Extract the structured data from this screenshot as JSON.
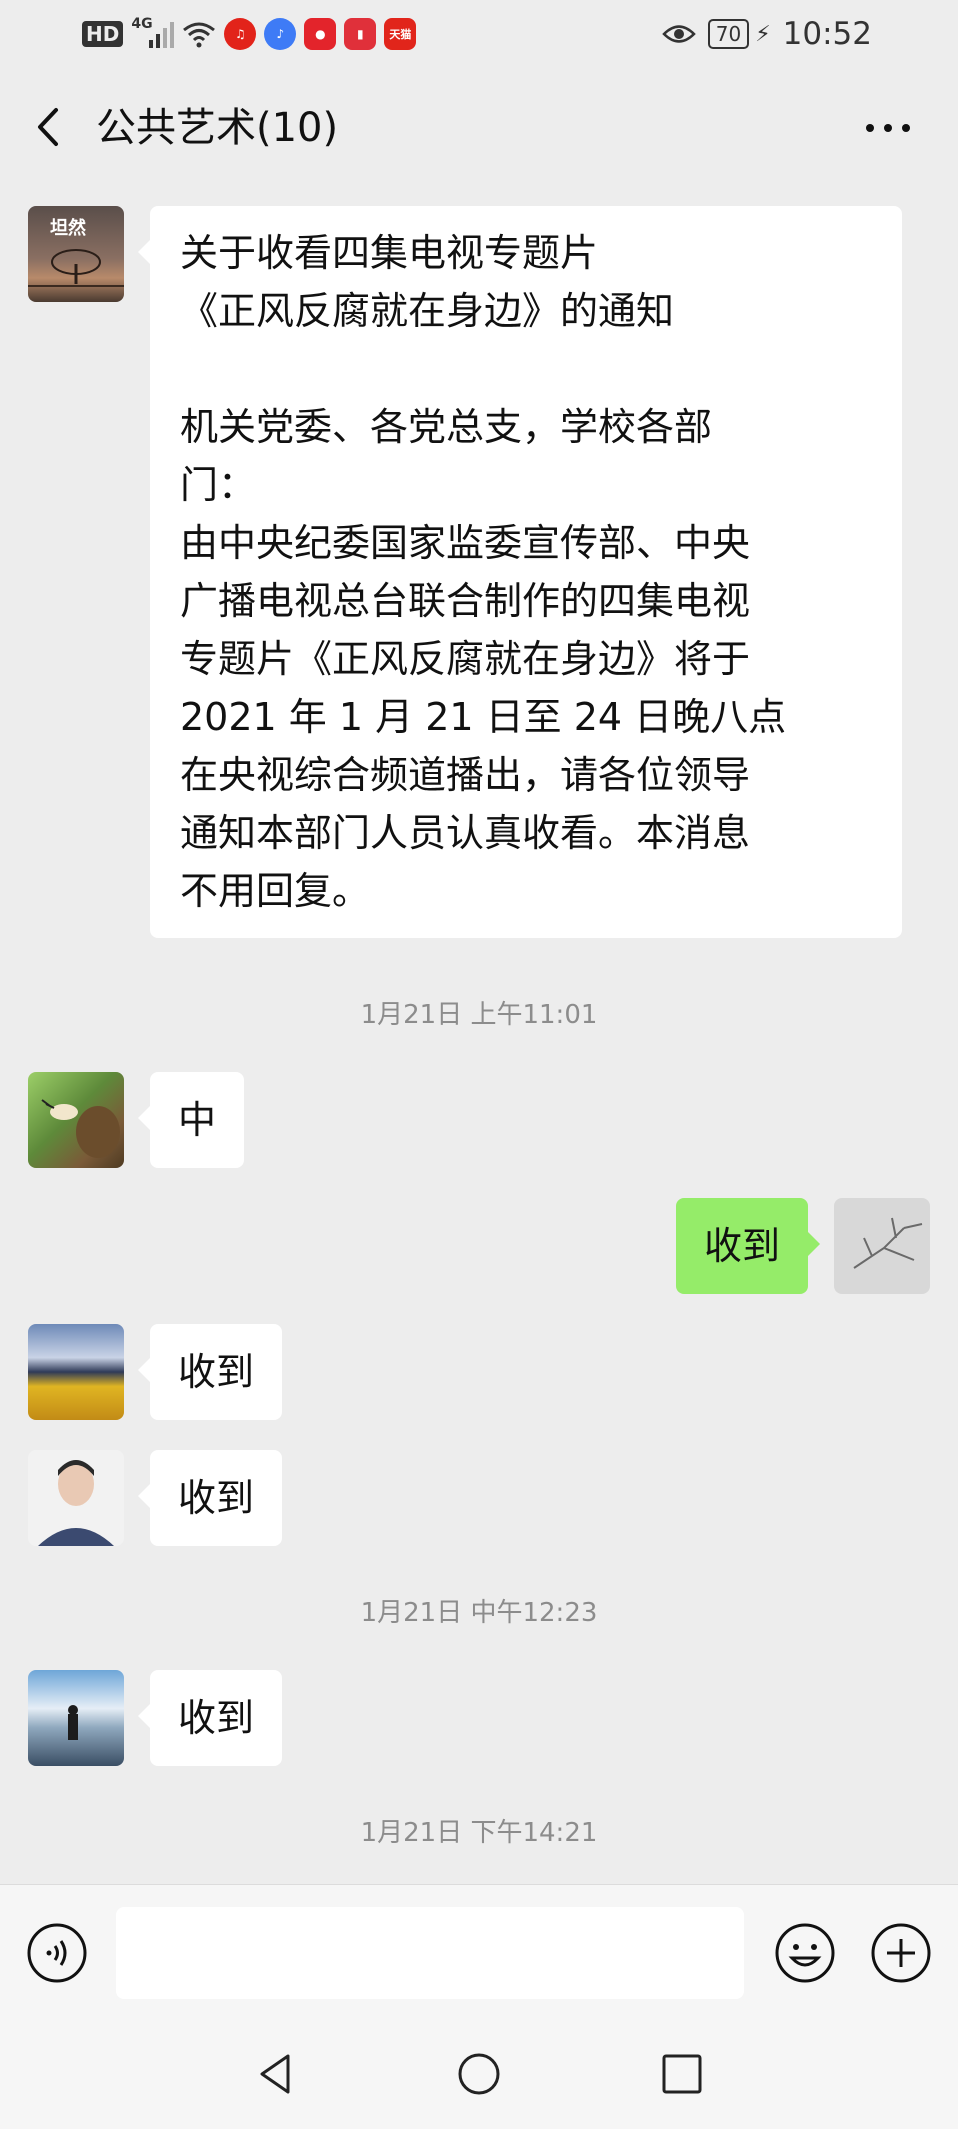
{
  "status_bar": {
    "network_badge": "HD",
    "network_type": "4G",
    "battery": "70",
    "time": "10:52",
    "app_badge_tmall": "天猫",
    "icons": [
      "hd-badge-icon",
      "signal-icon",
      "wifi-icon",
      "music-app-icon",
      "music-note-icon",
      "notification-app-icon",
      "reader-app-icon",
      "tmall-app-icon",
      "eye-icon",
      "battery-icon",
      "charging-icon"
    ]
  },
  "header": {
    "title": "公共艺术(10)",
    "icons": [
      "back-icon",
      "more-icon"
    ]
  },
  "messages": [
    {
      "sender_side": "left",
      "avatar": "tree-avatar",
      "avatar_text": "坦然",
      "text": "关于收看四集电视专题片\n《正风反腐就在身边》的通知\n\n机关党委、各党总支，学校各部\n门：\n由中央纪委国家监委宣传部、中央\n广播电视总台联合制作的四集电视\n专题片《正风反腐就在身边》将于\n2021 年 1 月 21 日至 24 日晚八点\n在央视综合频道播出，请各位领导\n通知本部门人员认真收看。本消息\n不用回复。"
    },
    {
      "timestamp": "1月21日 上午11:01"
    },
    {
      "sender_side": "left",
      "avatar": "bird-avatar",
      "text": "中"
    },
    {
      "sender_side": "right",
      "avatar": "branch-avatar",
      "text": "收到"
    },
    {
      "sender_side": "left",
      "avatar": "field-avatar",
      "text": "收到"
    },
    {
      "sender_side": "left",
      "avatar": "portrait-avatar",
      "text": "收到"
    },
    {
      "timestamp": "1月21日 中午12:23"
    },
    {
      "sender_side": "left",
      "avatar": "beach-avatar",
      "text": "收到"
    },
    {
      "timestamp": "1月21日 下午14:21"
    }
  ],
  "input_bar": {
    "placeholder": "",
    "icons": [
      "voice-icon",
      "emoji-icon",
      "plus-icon"
    ]
  },
  "system_nav": {
    "icons": [
      "nav-back-icon",
      "nav-home-icon",
      "nav-recents-icon"
    ]
  },
  "colors": {
    "background": "#ededed",
    "bubble_self": "#95ec69",
    "bubble_other": "#ffffff",
    "timestamp": "#8c8c8c"
  }
}
